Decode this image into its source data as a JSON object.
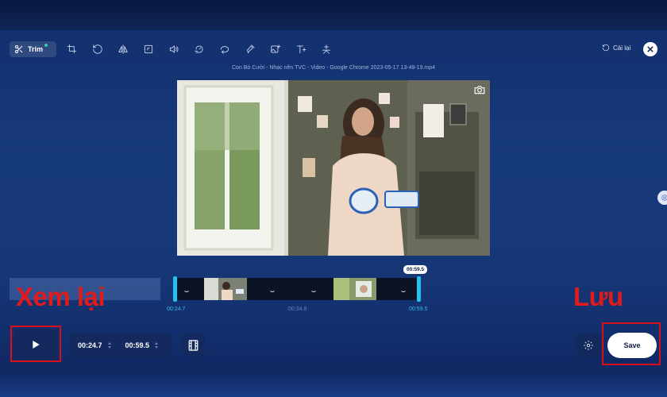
{
  "toolbar": {
    "trim_label": "Trim",
    "tools": [
      "scissors-icon",
      "crop-icon",
      "rotate-icon",
      "flip-icon",
      "frame-icon",
      "volume-icon",
      "speed-icon",
      "loop-icon",
      "hand-edit-icon",
      "image-add-icon",
      "text-icon",
      "magic-wand-icon"
    ]
  },
  "header": {
    "reset_label": "Cài lại",
    "file_title": "Con Bò Cười - Nhạc nền TVC - Video - Google Chrome 2023-05-17 13-49-19.mp4"
  },
  "timeline": {
    "start_time": "00:24.7",
    "mid_time": "00:34.8",
    "end_time": "00:59.5",
    "end_badge": "00:59.5"
  },
  "controls": {
    "start_value": "00:24.7",
    "end_value": "00:59.5",
    "save_label": "Save"
  },
  "annotations": {
    "left_text": "Xem lại",
    "right_text": "Lưu",
    "highlight_color": "#d8101a"
  },
  "colors": {
    "accent": "#22c2ee",
    "background": "#173a7c",
    "panel": "#142a5e"
  }
}
